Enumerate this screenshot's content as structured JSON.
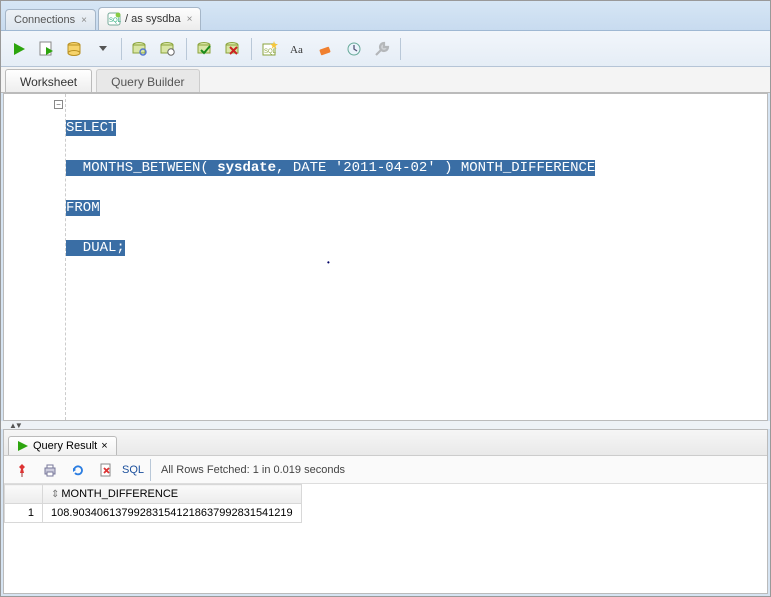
{
  "top_tabs": {
    "connections": "Connections",
    "session": "/ as sysdba"
  },
  "subtabs": {
    "worksheet": "Worksheet",
    "query_builder": "Query Builder"
  },
  "sql": {
    "l1a": "SELECT",
    "l2": "  MONTHS_BETWEEN( ",
    "l2b": "sysdate",
    "l2c": ", DATE '2011-04-02' ) MONTH_DIFFERENCE",
    "l3": "FROM",
    "l4": "  DUAL;"
  },
  "result_tab": "Query Result",
  "sql_link": "SQL",
  "status": "All Rows Fetched: 1 in 0.019 seconds",
  "grid": {
    "col1": "MONTH_DIFFERENCE",
    "row1_num": "1",
    "row1_val": "108.903406137992831541218637992831541219"
  }
}
